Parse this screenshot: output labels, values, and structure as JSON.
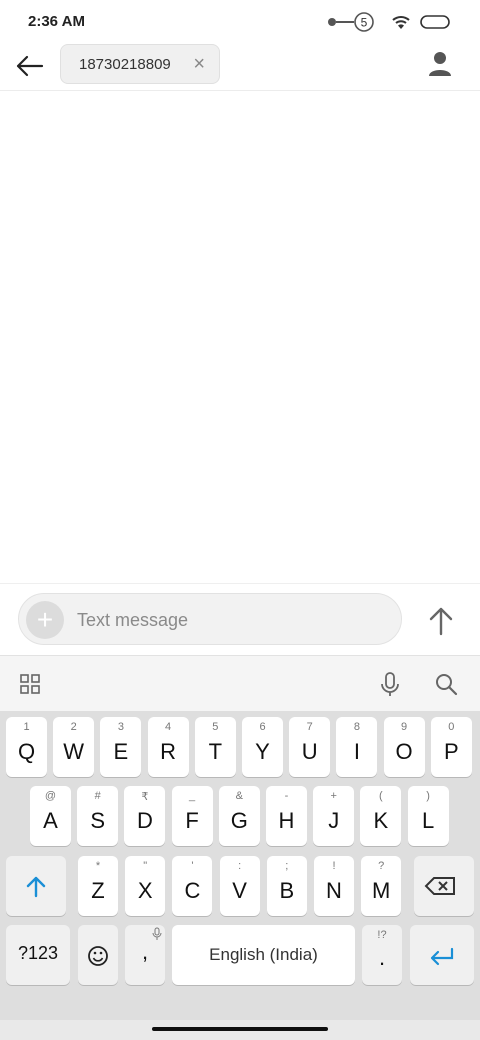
{
  "status_bar": {
    "time": "2:36 AM",
    "notification_count": "5"
  },
  "app_bar": {
    "recipient": "18730218809"
  },
  "compose": {
    "placeholder": "Text message"
  },
  "keyboard": {
    "row1": [
      {
        "hint": "1",
        "label": "Q"
      },
      {
        "hint": "2",
        "label": "W"
      },
      {
        "hint": "3",
        "label": "E"
      },
      {
        "hint": "4",
        "label": "R"
      },
      {
        "hint": "5",
        "label": "T"
      },
      {
        "hint": "6",
        "label": "Y"
      },
      {
        "hint": "7",
        "label": "U"
      },
      {
        "hint": "8",
        "label": "I"
      },
      {
        "hint": "9",
        "label": "O"
      },
      {
        "hint": "0",
        "label": "P"
      }
    ],
    "row2": [
      {
        "hint": "@",
        "label": "A"
      },
      {
        "hint": "#",
        "label": "S"
      },
      {
        "hint": "₹",
        "label": "D"
      },
      {
        "hint": "_",
        "label": "F"
      },
      {
        "hint": "&",
        "label": "G"
      },
      {
        "hint": "-",
        "label": "H"
      },
      {
        "hint": "+",
        "label": "J"
      },
      {
        "hint": "(",
        "label": "K"
      },
      {
        "hint": ")",
        "label": "L"
      }
    ],
    "row3": [
      {
        "hint": "*",
        "label": "Z"
      },
      {
        "hint": "\"",
        "label": "X"
      },
      {
        "hint": "'",
        "label": "C"
      },
      {
        "hint": ":",
        "label": "V"
      },
      {
        "hint": ";",
        "label": "B"
      },
      {
        "hint": "!",
        "label": "N"
      },
      {
        "hint": "?",
        "label": "M"
      }
    ],
    "symbols_label": "?123",
    "comma_label": ",",
    "space_label": "English (India)",
    "period_hint": "!?",
    "period_label": ".",
    "accent_color": "#1a8fd6"
  }
}
